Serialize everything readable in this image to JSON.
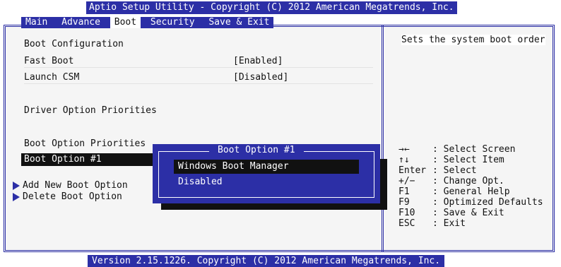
{
  "app": {
    "title": "Aptio Setup Utility - Copyright (C) 2012 American Megatrends, Inc.",
    "footer": "Version 2.15.1226. Copyright (C) 2012 American Megatrends, Inc."
  },
  "menu": {
    "tabs": [
      {
        "label": "Main"
      },
      {
        "label": "Advance"
      },
      {
        "label": "Boot"
      },
      {
        "label": "Security"
      },
      {
        "label": "Save & Exit"
      }
    ],
    "active": "Boot"
  },
  "left": {
    "boot_configuration": "Boot Configuration",
    "fast_boot_label": "Fast Boot",
    "fast_boot_value": "[Enabled]",
    "launch_csm_label": "Launch CSM",
    "launch_csm_value": "[Disabled]",
    "driver_option_priorities": "Driver Option Priorities",
    "boot_option_priorities": "Boot Option Priorities",
    "boot_option_1": "Boot Option #1",
    "add_new_boot_option": "Add New Boot Option",
    "delete_boot_option": "Delete Boot Option"
  },
  "popup": {
    "title": "Boot Option #1",
    "options": [
      "Windows Boot Manager",
      "Disabled"
    ],
    "highlighted_index": 0
  },
  "help": {
    "description": "Sets the system boot order",
    "keys": [
      {
        "key": "→←",
        "desc": ": Select Screen"
      },
      {
        "key": "↑↓",
        "desc": ": Select Item"
      },
      {
        "key": "Enter",
        "desc": ": Select"
      },
      {
        "key": "+/−",
        "desc": ": Change Opt."
      },
      {
        "key": "F1",
        "desc": ": General Help"
      },
      {
        "key": "F9",
        "desc": ": Optimized Defaults"
      },
      {
        "key": "F10",
        "desc": ": Save & Exit"
      },
      {
        "key": "ESC",
        "desc": ": Exit"
      }
    ]
  },
  "colors": {
    "bios_blue": "#2c2fa6",
    "highlight": "#111111",
    "text": "#111111"
  }
}
